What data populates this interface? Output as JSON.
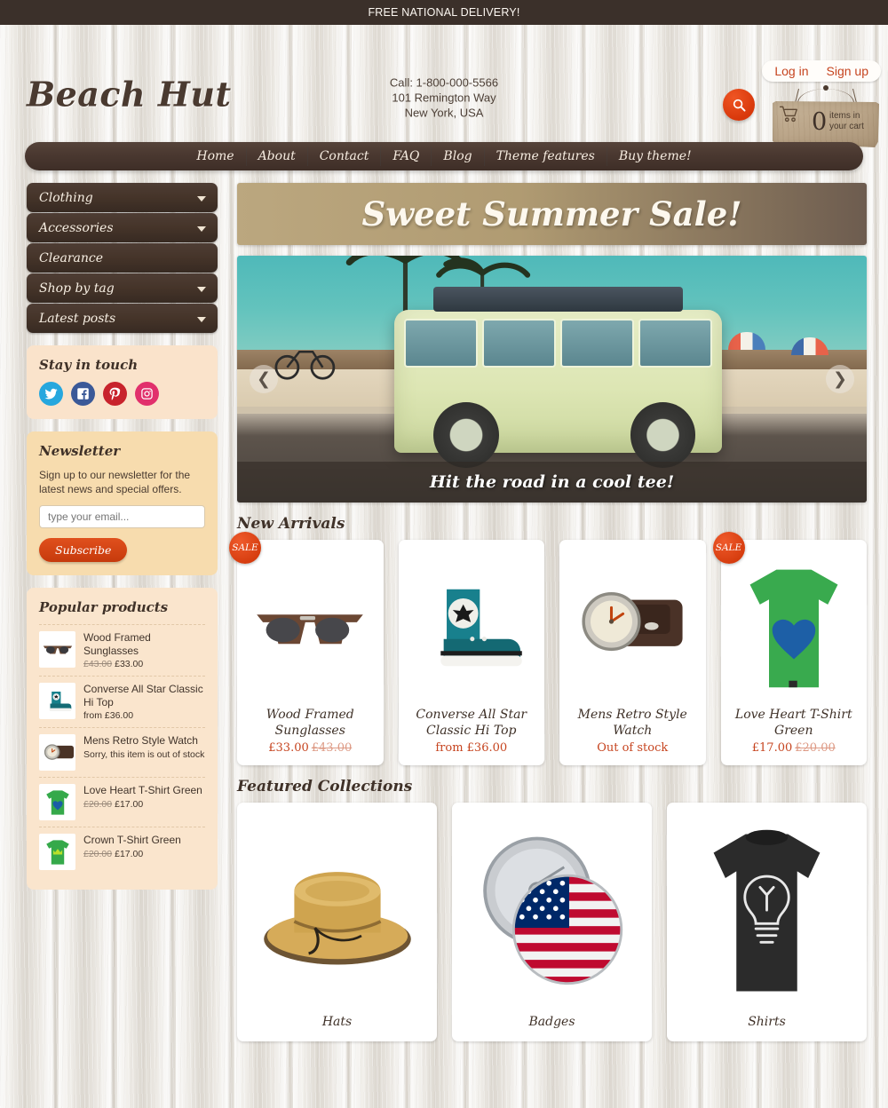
{
  "announcement": "FREE NATIONAL DELIVERY!",
  "header": {
    "logo": "Beach Hut",
    "phone": "Call: 1-800-000-5566",
    "address_line1": "101 Remington Way",
    "address_line2": "New York, USA",
    "login_label": "Log in",
    "signup_label": "Sign up",
    "search_icon": "search-icon",
    "cart": {
      "icon": "shopping-cart-icon",
      "count": "0",
      "label_line1": "items in",
      "label_line2": "your cart"
    }
  },
  "nav": {
    "items": [
      {
        "label": "Home"
      },
      {
        "label": "About"
      },
      {
        "label": "Contact"
      },
      {
        "label": "FAQ"
      },
      {
        "label": "Blog"
      },
      {
        "label": "Theme features"
      },
      {
        "label": "Buy theme!"
      }
    ]
  },
  "sidebar": {
    "accordion": [
      {
        "label": "Clothing",
        "has_caret": true
      },
      {
        "label": "Accessories",
        "has_caret": true
      },
      {
        "label": "Clearance",
        "has_caret": false
      },
      {
        "label": "Shop by tag",
        "has_caret": true
      },
      {
        "label": "Latest posts",
        "has_caret": true
      }
    ],
    "social": {
      "title": "Stay in touch",
      "items": [
        {
          "name": "twitter-icon",
          "color": "#26A7DE"
        },
        {
          "name": "facebook-icon",
          "color": "#3B5998"
        },
        {
          "name": "pinterest-icon",
          "color": "#C8232C"
        },
        {
          "name": "instagram-icon",
          "color": "#E1306C"
        }
      ]
    },
    "newsletter": {
      "title": "Newsletter",
      "description": "Sign up to our newsletter for the latest news and special offers.",
      "placeholder": "type your email...",
      "button_label": "Subscribe"
    },
    "popular": {
      "title": "Popular products",
      "items": [
        {
          "name": "Wood Framed Sunglasses",
          "old_price": "£43.00",
          "price": "£33.00",
          "status": ""
        },
        {
          "name": "Converse All Star Classic Hi Top",
          "old_price": "",
          "price": "from £36.00",
          "status": ""
        },
        {
          "name": "Mens Retro Style Watch",
          "old_price": "",
          "price": "",
          "status": "Sorry, this item is out of stock"
        },
        {
          "name": "Love Heart T-Shirt Green",
          "old_price": "£20.00",
          "price": "£17.00",
          "status": ""
        },
        {
          "name": "Crown T-Shirt Green",
          "old_price": "£20.00",
          "price": "£17.00",
          "status": ""
        }
      ]
    }
  },
  "main": {
    "sale_banner": "Sweet Summer Sale!",
    "hero": {
      "caption": "Hit the road in a cool tee!",
      "prev_icon": "chevron-left-icon",
      "next_icon": "chevron-right-icon"
    },
    "new_arrivals": {
      "title": "New Arrivals",
      "sale_badge": "SALE",
      "products": [
        {
          "name": "Wood Framed Sunglasses",
          "price": "£33.00",
          "old_price": "£43.00",
          "on_sale": true
        },
        {
          "name": "Converse All Star Classic Hi Top",
          "price": "from £36.00",
          "old_price": "",
          "on_sale": false
        },
        {
          "name": "Mens Retro Style Watch",
          "price": "Out of stock",
          "old_price": "",
          "on_sale": false
        },
        {
          "name": "Love Heart T-Shirt Green",
          "price": "£17.00",
          "old_price": "£20.00",
          "on_sale": true
        }
      ]
    },
    "featured_collections": {
      "title": "Featured Collections",
      "items": [
        {
          "label": "Hats"
        },
        {
          "label": "Badges"
        },
        {
          "label": "Shirts"
        }
      ]
    }
  },
  "colors": {
    "accent": "#C6441F",
    "dark_brown": "#3B302A",
    "panel_peach": "#FAE3CB",
    "panel_tan": "#F7DCAE"
  }
}
